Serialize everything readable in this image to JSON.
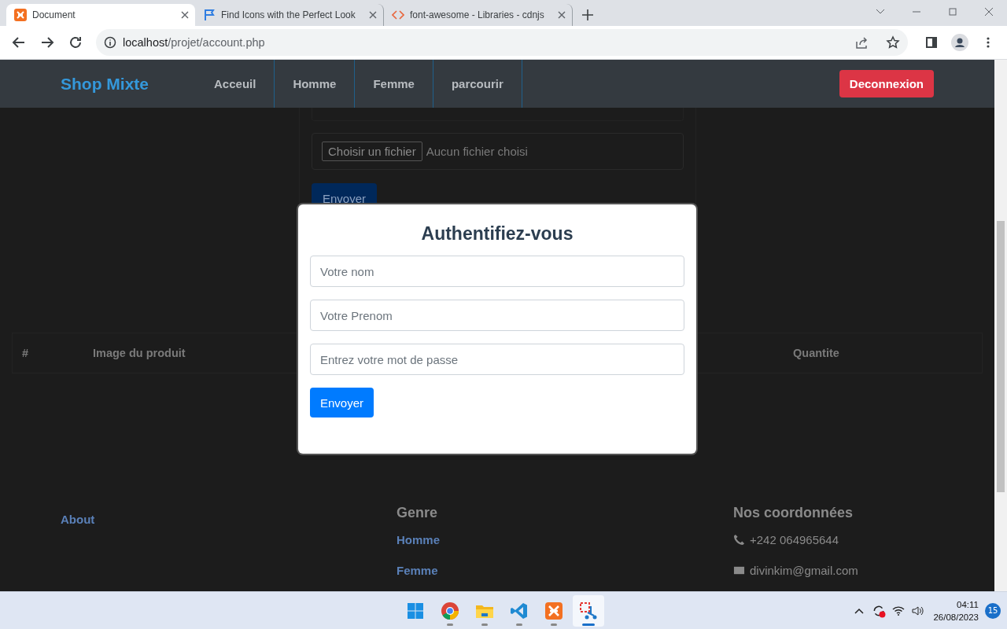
{
  "browser": {
    "tabs": [
      {
        "title": "Document",
        "kind": "xampp",
        "selected": true
      },
      {
        "title": "Find Icons with the Perfect Look",
        "kind": "flag",
        "selected": false
      },
      {
        "title": "font-awesome - Libraries - cdnjs",
        "kind": "code",
        "selected": false
      }
    ],
    "url": {
      "host": "localhost",
      "path": "/projet/account.php"
    }
  },
  "navbar": {
    "brand": "Shop Mixte",
    "links": [
      "Acceuil",
      "Homme",
      "Femme",
      "parcourir"
    ],
    "logout": "Deconnexion"
  },
  "background_form": {
    "file_button": "Choisir un fichier",
    "file_status": "Aucun fichier choisi",
    "submit": "Envoyer"
  },
  "table": {
    "columns": [
      "#",
      "Image du produit",
      "Quantite"
    ]
  },
  "footer": {
    "about": "About",
    "genre": {
      "heading": "Genre",
      "links": [
        "Homme",
        "Femme"
      ]
    },
    "contact": {
      "heading": "Nos coordonnées",
      "items": [
        {
          "kind": "phone",
          "text": "+242 064965644"
        },
        {
          "kind": "mail",
          "text": "divinkim@gmail.com"
        }
      ]
    }
  },
  "modal": {
    "title": "Authentifiez-vous",
    "fields": [
      {
        "placeholder": "Votre nom"
      },
      {
        "placeholder": "Votre Prenom"
      },
      {
        "placeholder": "Entrez votre mot de passe"
      }
    ],
    "submit": "Envoyer"
  },
  "taskbar": {
    "apps": [
      {
        "kind": "windows",
        "running": false,
        "selected": false
      },
      {
        "kind": "chrome",
        "running": true,
        "selected": false
      },
      {
        "kind": "folder",
        "running": true,
        "selected": false
      },
      {
        "kind": "vscode",
        "running": true,
        "selected": false
      },
      {
        "kind": "xampp",
        "running": true,
        "selected": false
      },
      {
        "kind": "snip",
        "running": true,
        "selected": true
      }
    ],
    "time": "04:11",
    "date": "26/08/2023",
    "notifications": "15"
  }
}
